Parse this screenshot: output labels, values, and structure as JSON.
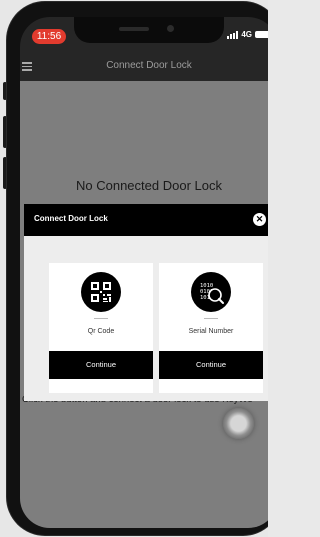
{
  "status_bar": {
    "time": "11:56",
    "network": "4G"
  },
  "header": {
    "title": "Connect Door Lock"
  },
  "main": {
    "empty_title": "No Connected Door Lock",
    "hint": "Click the button and connect a door lock to use KeyWe"
  },
  "modal": {
    "title": "Connect Door Lock",
    "close_label": "✕",
    "options": [
      {
        "icon": "qr-code-icon",
        "label": "Qr Code",
        "button": "Continue"
      },
      {
        "icon": "serial-number-icon",
        "label": "Serial Number",
        "button": "Continue"
      }
    ]
  },
  "colors": {
    "status_pill": "#e23b2e",
    "overlay": "#7e7e7e",
    "modal_header": "#000000",
    "button": "#000000"
  }
}
